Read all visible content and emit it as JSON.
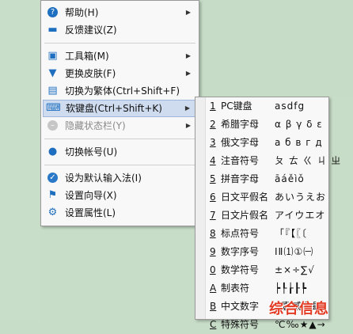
{
  "main_menu": [
    {
      "label": "帮助(H)",
      "icon": "help-icon",
      "arrow": true
    },
    {
      "label": "反馈建议(Z)",
      "icon": "feedback-icon",
      "arrow": false
    },
    {
      "sep": true
    },
    {
      "label": "工具箱(M)",
      "icon": "toolbox-icon",
      "arrow": true
    },
    {
      "label": "更换皮肤(F)",
      "icon": "shirt-icon",
      "arrow": true
    },
    {
      "label": "切换为繁体(Ctrl+Shift+F)",
      "icon": "document-icon",
      "arrow": false
    },
    {
      "label": "软键盘(Ctrl+Shift+K)",
      "icon": "keyboard-icon",
      "arrow": true,
      "highlight": true
    },
    {
      "label": "隐藏状态栏(Y)",
      "icon": "hide-icon",
      "arrow": true,
      "disabled": true
    },
    {
      "sep": true
    },
    {
      "label": "切换帐号(U)",
      "icon": "user-icon",
      "arrow": false
    },
    {
      "sep": true
    },
    {
      "label": "设为默认输入法(I)",
      "icon": "check-icon",
      "arrow": false
    },
    {
      "label": "设置向导(X)",
      "icon": "flag-icon",
      "arrow": false
    },
    {
      "label": "设置属性(L)",
      "icon": "gear-icon",
      "arrow": false
    }
  ],
  "sub_menu": [
    {
      "key": "1",
      "name": "PC键盘",
      "chars": "asdfg"
    },
    {
      "key": "2",
      "name": "希腊字母",
      "chars": "α β γ δ ε"
    },
    {
      "key": "3",
      "name": "俄文字母",
      "chars": "а б в г д"
    },
    {
      "key": "4",
      "name": "注音符号",
      "chars": "ㄆ ㄊ ㄍ ㄐ ㄓ"
    },
    {
      "key": "5",
      "name": "拼音字母",
      "chars": "āáěìǒ"
    },
    {
      "key": "6",
      "name": "日文平假名",
      "chars": "あいうえお"
    },
    {
      "key": "7",
      "name": "日文片假名",
      "chars": "アイウエオ"
    },
    {
      "key": "8",
      "name": "标点符号",
      "chars": "「『【〖〔"
    },
    {
      "key": "9",
      "name": "数字序号",
      "chars": "ⅠⅡ⑴①㈠"
    },
    {
      "key": "0",
      "name": "数学符号",
      "chars": "±×÷∑√"
    },
    {
      "key": "A",
      "name": "制表符",
      "chars": "┝┞┟┠┡"
    },
    {
      "key": "B",
      "name": "中文数字",
      "chars": "$壹贰叁肆"
    },
    {
      "key": "C",
      "name": "特殊符号",
      "chars": "℃‰★▲→"
    }
  ],
  "watermark": "综合信息"
}
